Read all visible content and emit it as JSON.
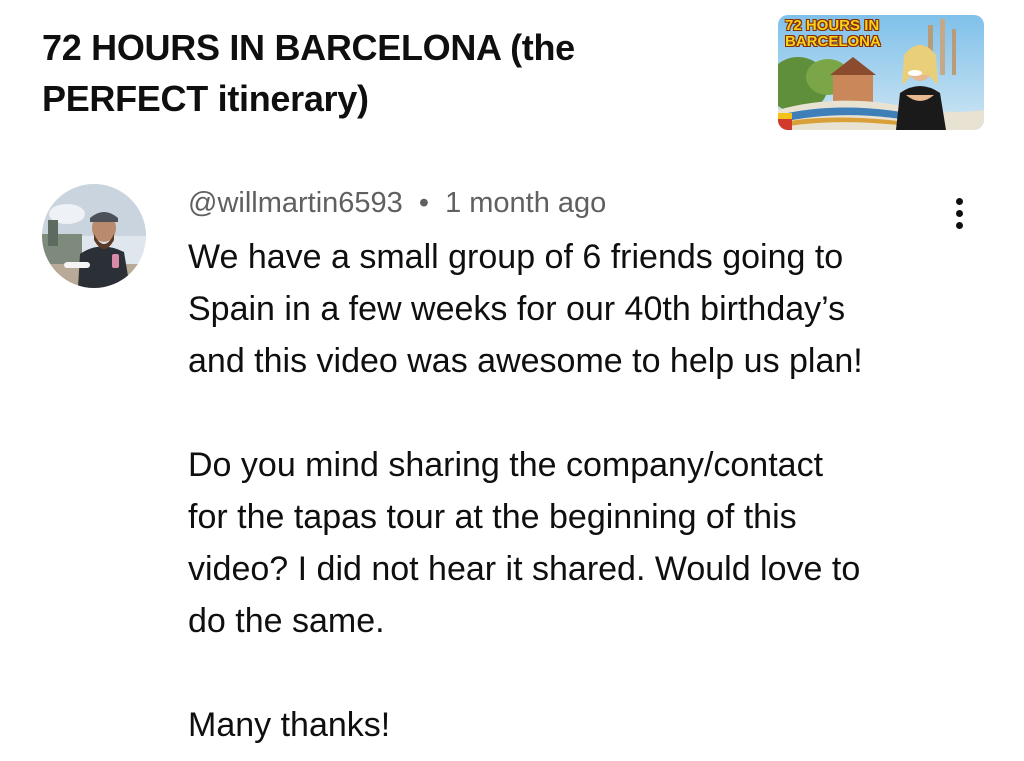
{
  "video": {
    "title": "72 HOURS IN BARCELONA (the PERFECT itinerary)",
    "thumbnail_text": "72 HOURS IN BARCELONA"
  },
  "comment": {
    "author": "@willmartin6593",
    "separator": "•",
    "timestamp": "1 month ago",
    "paragraphs": [
      "We have a small group of 6 friends going to\nSpain in a few weeks for our 40th birthday’s\nand this video was awesome to help us plan!",
      "Do you mind sharing the company/contact\nfor the tapas tour at the beginning of this\nvideo? I did not hear it shared. Would love to\ndo the same.",
      "Many thanks!"
    ],
    "menu_icon": "more-vertical-icon"
  }
}
